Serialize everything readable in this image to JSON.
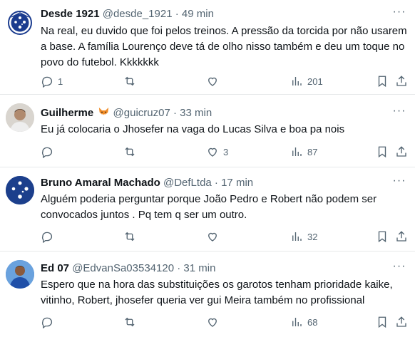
{
  "tweets": [
    {
      "name": "Desde 1921",
      "handle": "@desde_1921",
      "separator": "·",
      "time": "49 min",
      "text": "Na real, eu duvido que foi pelos treinos. A pressão da torcida por não usarem a base. A família Lourenço deve tá de olho nisso também e deu um toque no povo do futebol. Kkkkkkk",
      "replies": "1",
      "retweets": "",
      "likes": "",
      "views": "201"
    },
    {
      "name": "Guilherme",
      "handle": "@guicruz07",
      "separator": "·",
      "time": "33 min",
      "text": "Eu já colocaria o Jhosefer na vaga do Lucas Silva e boa pa nois",
      "replies": "",
      "retweets": "",
      "likes": "3",
      "views": "87"
    },
    {
      "name": "Bruno Amaral Machado",
      "handle": "@DefLtda",
      "separator": "·",
      "time": "17 min",
      "text": "Alguém poderia perguntar porque João Pedro e Robert não podem ser convocados juntos . Pq tem q ser um outro.",
      "replies": "",
      "retweets": "",
      "likes": "",
      "views": "32"
    },
    {
      "name": "Ed 07",
      "handle": "@EdvanSa03534120",
      "separator": "·",
      "time": "31 min",
      "text": "Espero que na hora das substituições os garotos tenham prioridade  kaike, vitinho, Robert, jhosefer queria ver gui Meira também no profissional",
      "replies": "",
      "retweets": "",
      "likes": "",
      "views": "68"
    }
  ],
  "icons": {
    "more": "more-icon",
    "reply": "reply-icon",
    "retweet": "retweet-icon",
    "like": "like-icon",
    "views": "views-icon",
    "bookmark": "bookmark-icon",
    "share": "share-icon"
  },
  "colors": {
    "text": "#0f1419",
    "secondary": "#536471",
    "divider": "#e7e9ea",
    "cruzeiro_blue": "#1b3c8f"
  }
}
